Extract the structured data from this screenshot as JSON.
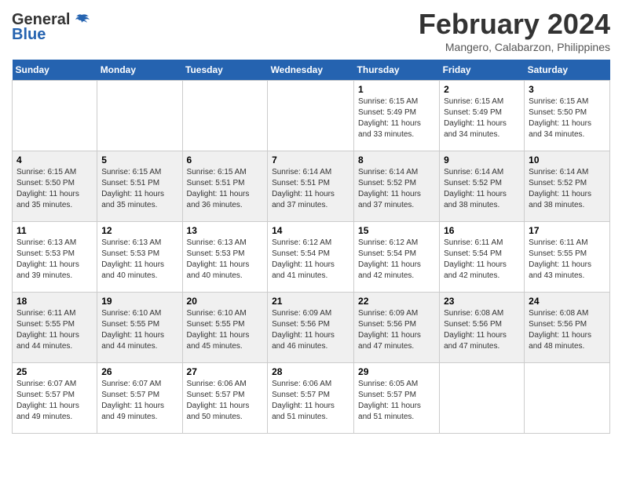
{
  "logo": {
    "text_general": "General",
    "text_blue": "Blue"
  },
  "title": {
    "month": "February 2024",
    "location": "Mangero, Calabarzon, Philippines"
  },
  "headers": [
    "Sunday",
    "Monday",
    "Tuesday",
    "Wednesday",
    "Thursday",
    "Friday",
    "Saturday"
  ],
  "weeks": [
    [
      {
        "day": "",
        "info": ""
      },
      {
        "day": "",
        "info": ""
      },
      {
        "day": "",
        "info": ""
      },
      {
        "day": "",
        "info": ""
      },
      {
        "day": "1",
        "info": "Sunrise: 6:15 AM\nSunset: 5:49 PM\nDaylight: 11 hours\nand 33 minutes."
      },
      {
        "day": "2",
        "info": "Sunrise: 6:15 AM\nSunset: 5:49 PM\nDaylight: 11 hours\nand 34 minutes."
      },
      {
        "day": "3",
        "info": "Sunrise: 6:15 AM\nSunset: 5:50 PM\nDaylight: 11 hours\nand 34 minutes."
      }
    ],
    [
      {
        "day": "4",
        "info": "Sunrise: 6:15 AM\nSunset: 5:50 PM\nDaylight: 11 hours\nand 35 minutes."
      },
      {
        "day": "5",
        "info": "Sunrise: 6:15 AM\nSunset: 5:51 PM\nDaylight: 11 hours\nand 35 minutes."
      },
      {
        "day": "6",
        "info": "Sunrise: 6:15 AM\nSunset: 5:51 PM\nDaylight: 11 hours\nand 36 minutes."
      },
      {
        "day": "7",
        "info": "Sunrise: 6:14 AM\nSunset: 5:51 PM\nDaylight: 11 hours\nand 37 minutes."
      },
      {
        "day": "8",
        "info": "Sunrise: 6:14 AM\nSunset: 5:52 PM\nDaylight: 11 hours\nand 37 minutes."
      },
      {
        "day": "9",
        "info": "Sunrise: 6:14 AM\nSunset: 5:52 PM\nDaylight: 11 hours\nand 38 minutes."
      },
      {
        "day": "10",
        "info": "Sunrise: 6:14 AM\nSunset: 5:52 PM\nDaylight: 11 hours\nand 38 minutes."
      }
    ],
    [
      {
        "day": "11",
        "info": "Sunrise: 6:13 AM\nSunset: 5:53 PM\nDaylight: 11 hours\nand 39 minutes."
      },
      {
        "day": "12",
        "info": "Sunrise: 6:13 AM\nSunset: 5:53 PM\nDaylight: 11 hours\nand 40 minutes."
      },
      {
        "day": "13",
        "info": "Sunrise: 6:13 AM\nSunset: 5:53 PM\nDaylight: 11 hours\nand 40 minutes."
      },
      {
        "day": "14",
        "info": "Sunrise: 6:12 AM\nSunset: 5:54 PM\nDaylight: 11 hours\nand 41 minutes."
      },
      {
        "day": "15",
        "info": "Sunrise: 6:12 AM\nSunset: 5:54 PM\nDaylight: 11 hours\nand 42 minutes."
      },
      {
        "day": "16",
        "info": "Sunrise: 6:11 AM\nSunset: 5:54 PM\nDaylight: 11 hours\nand 42 minutes."
      },
      {
        "day": "17",
        "info": "Sunrise: 6:11 AM\nSunset: 5:55 PM\nDaylight: 11 hours\nand 43 minutes."
      }
    ],
    [
      {
        "day": "18",
        "info": "Sunrise: 6:11 AM\nSunset: 5:55 PM\nDaylight: 11 hours\nand 44 minutes."
      },
      {
        "day": "19",
        "info": "Sunrise: 6:10 AM\nSunset: 5:55 PM\nDaylight: 11 hours\nand 44 minutes."
      },
      {
        "day": "20",
        "info": "Sunrise: 6:10 AM\nSunset: 5:55 PM\nDaylight: 11 hours\nand 45 minutes."
      },
      {
        "day": "21",
        "info": "Sunrise: 6:09 AM\nSunset: 5:56 PM\nDaylight: 11 hours\nand 46 minutes."
      },
      {
        "day": "22",
        "info": "Sunrise: 6:09 AM\nSunset: 5:56 PM\nDaylight: 11 hours\nand 47 minutes."
      },
      {
        "day": "23",
        "info": "Sunrise: 6:08 AM\nSunset: 5:56 PM\nDaylight: 11 hours\nand 47 minutes."
      },
      {
        "day": "24",
        "info": "Sunrise: 6:08 AM\nSunset: 5:56 PM\nDaylight: 11 hours\nand 48 minutes."
      }
    ],
    [
      {
        "day": "25",
        "info": "Sunrise: 6:07 AM\nSunset: 5:57 PM\nDaylight: 11 hours\nand 49 minutes."
      },
      {
        "day": "26",
        "info": "Sunrise: 6:07 AM\nSunset: 5:57 PM\nDaylight: 11 hours\nand 49 minutes."
      },
      {
        "day": "27",
        "info": "Sunrise: 6:06 AM\nSunset: 5:57 PM\nDaylight: 11 hours\nand 50 minutes."
      },
      {
        "day": "28",
        "info": "Sunrise: 6:06 AM\nSunset: 5:57 PM\nDaylight: 11 hours\nand 51 minutes."
      },
      {
        "day": "29",
        "info": "Sunrise: 6:05 AM\nSunset: 5:57 PM\nDaylight: 11 hours\nand 51 minutes."
      },
      {
        "day": "",
        "info": ""
      },
      {
        "day": "",
        "info": ""
      }
    ]
  ]
}
